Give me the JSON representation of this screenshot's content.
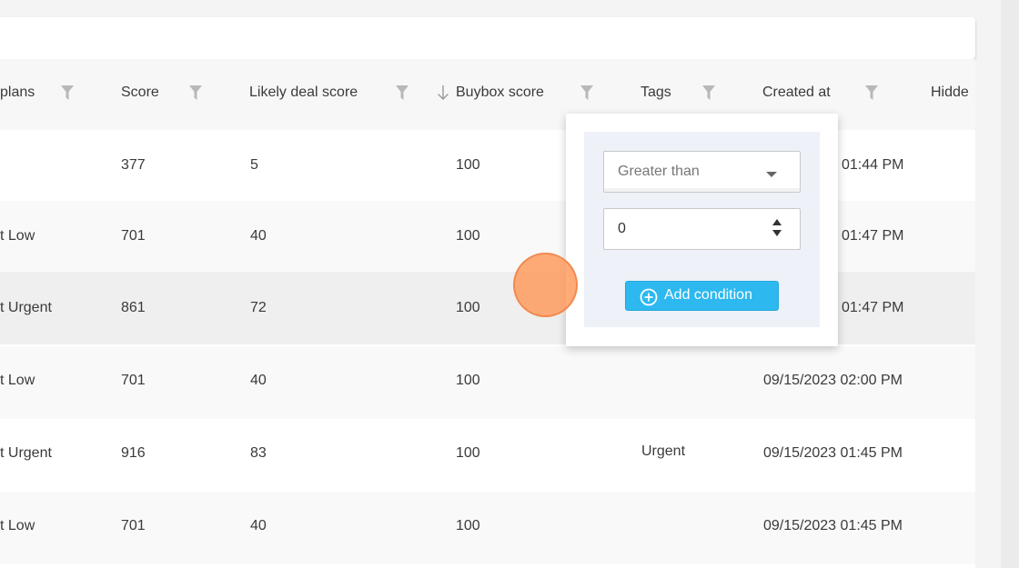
{
  "colors": {
    "accent": "#2db9ef",
    "cursor": "#ff9a5c"
  },
  "columns": [
    {
      "label": "plans"
    },
    {
      "label": "Score"
    },
    {
      "label": "Likely deal score"
    },
    {
      "label": "Buybox score"
    },
    {
      "label": "Tags"
    },
    {
      "label": "Created at"
    },
    {
      "label": "Hidde"
    }
  ],
  "rows": [
    {
      "plans": "",
      "score": "377",
      "likely": "5",
      "buybox": "100",
      "tags": "",
      "created": "01:44 PM"
    },
    {
      "plans": "t Low",
      "score": "701",
      "likely": "40",
      "buybox": "100",
      "tags": "",
      "created": "01:47 PM"
    },
    {
      "plans": "t Urgent",
      "score": "861",
      "likely": "72",
      "buybox": "100",
      "tags": "",
      "created": "01:47 PM"
    },
    {
      "plans": "t Low",
      "score": "701",
      "likely": "40",
      "buybox": "100",
      "tags": "",
      "created": "09/15/2023 02:00 PM"
    },
    {
      "plans": "t Urgent",
      "score": "916",
      "likely": "83",
      "buybox": "100",
      "tags": "Urgent",
      "created": "09/15/2023 01:45 PM"
    },
    {
      "plans": "t Low",
      "score": "701",
      "likely": "40",
      "buybox": "100",
      "tags": "",
      "created": "09/15/2023 01:45 PM"
    }
  ],
  "filter_popup": {
    "operator": "Greater than",
    "value": "0",
    "add_condition_label": "Add condition"
  },
  "icons": {
    "filter": "filter-icon",
    "sort": "arrow-down-icon",
    "add": "plus-circle-icon",
    "dropdown": "caret-down-icon"
  }
}
